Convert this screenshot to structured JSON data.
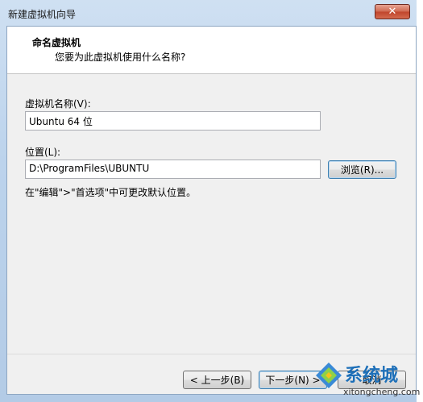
{
  "window": {
    "title": "新建虚拟机向导",
    "close_label": "✕"
  },
  "header": {
    "title": "命名虚拟机",
    "subtitle": "您要为此虚拟机使用什么名称?"
  },
  "form": {
    "vm_name_label": "虚拟机名称(V):",
    "vm_name_value": "Ubuntu 64 位",
    "location_label": "位置(L):",
    "location_value": "D:\\ProgramFiles\\UBUNTU",
    "browse_label": "浏览(R)...",
    "hint": "在\"编辑\">\"首选项\"中可更改默认位置。"
  },
  "footer": {
    "back_label": "< 上一步(B)",
    "next_label": "下一步(N) >",
    "cancel_label": "取消"
  },
  "watermark": {
    "brand": "系统城",
    "url": "xitongcheng.com"
  }
}
